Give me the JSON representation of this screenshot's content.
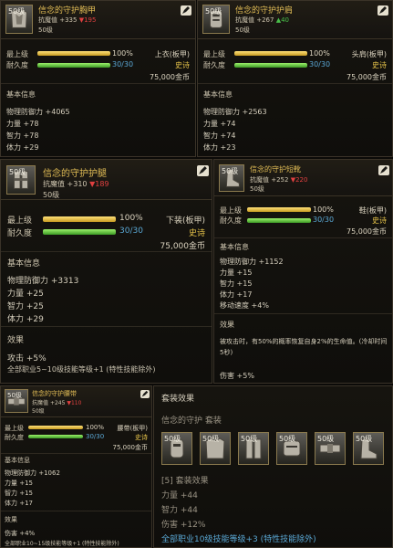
{
  "colors": {
    "gold": "#e2bd56",
    "reduce": "#e04040",
    "increase": "#49c04a",
    "cyan": "#5aa7d4",
    "durability": "#3c9a25",
    "upgrade": "#c79b21"
  },
  "labels": {
    "upgrade": "最上级",
    "durability": "耐久度",
    "basic": "基本信息",
    "effect": "效果",
    "rarity": "史诗"
  },
  "items": {
    "chest": {
      "title": "信念的守护胸甲",
      "icon": "chest-armor-icon",
      "level_badge": "50级",
      "atk_label": "抗魔值",
      "atk_up": "+335",
      "atk_down": "▼195",
      "level": "50级",
      "upgrade_pct": "100%",
      "upgrade_value": 1.0,
      "dur": "30/30",
      "dur_value": 1.0,
      "slot": "上衣(板甲)",
      "rarity": "史诗",
      "price": "75,000金币",
      "defense": "物理防御力 +4065",
      "stats": [
        "力量 +78",
        "智力 +78",
        "体力 +29"
      ]
    },
    "shoulder": {
      "title": "信念的守护护肩",
      "icon": "shoulder-armor-icon",
      "level_badge": "50级",
      "atk_label": "抗魔值",
      "atk_up": "+267",
      "atk_up2": "▲40",
      "level": "50级",
      "upgrade_pct": "100%",
      "upgrade_value": 1.0,
      "dur": "30/30",
      "dur_value": 1.0,
      "slot": "头肩(板甲)",
      "rarity": "史诗",
      "price": "75,000金币",
      "defense": "物理防御力 +2563",
      "stats": [
        "力量 +74",
        "智力 +74",
        "体力 +23"
      ]
    },
    "legs": {
      "title": "信念的守护护腿",
      "icon": "leg-armor-icon",
      "level_badge": "50级",
      "atk_label": "抗魔值",
      "atk_up": "+310",
      "atk_down": "▼189",
      "level": "50级",
      "upgrade_pct": "100%",
      "upgrade_value": 1.0,
      "dur": "30/30",
      "dur_value": 1.0,
      "slot": "下装(板甲)",
      "rarity": "史诗",
      "price": "75,000金币",
      "defense": "物理防御力 +3313",
      "stats": [
        "力量 +25",
        "智力 +25",
        "体力 +29"
      ],
      "effects": [
        "攻击 +5%",
        "全部职业5~10级技能等级+1 (特性技能除外)"
      ]
    },
    "boots": {
      "title": "信念的守护短靴",
      "icon": "boots-icon",
      "level_badge": "50级",
      "atk_label": "抗魔值",
      "atk_up": "+252",
      "atk_down": "▼220",
      "level": "50级",
      "upgrade_pct": "100%",
      "upgrade_value": 1.0,
      "dur": "30/30",
      "dur_value": 1.0,
      "slot": "鞋(板甲)",
      "rarity": "史诗",
      "price": "75,000金币",
      "defense": "物理防御力 +1152",
      "stats": [
        "力量 +15",
        "智力 +15",
        "体力 +17",
        "移动速度 +4%"
      ],
      "effects": [
        "被攻击时，有50%的概率恢复自身2%的生命值。(冷却时间5秒)",
        "伤害 +5%"
      ]
    },
    "belt": {
      "title": "信念的守护腰带",
      "icon": "belt-icon",
      "level_badge": "50级",
      "atk_label": "抗魔值",
      "atk_up": "+245",
      "atk_down": "▼110",
      "level": "50级",
      "upgrade_pct": "100%",
      "upgrade_value": 1.0,
      "dur": "30/30",
      "dur_value": 1.0,
      "slot": "腰带(板甲)",
      "rarity": "史诗",
      "price": "75,000金币",
      "defense": "物理防御力 +1062",
      "stats": [
        "力量 +15",
        "智力 +15",
        "体力 +17"
      ],
      "effects": [
        "伤害 +4%",
        "全部职业10~15级技能等级+1 (特性技能除外)"
      ]
    }
  },
  "set": {
    "title": "套装效果",
    "name": "信念的守护 套装",
    "icons": [
      {
        "level": "50级",
        "name": "helmet-icon"
      },
      {
        "level": "50级",
        "name": "chest-armor-icon"
      },
      {
        "level": "50级",
        "name": "leg-armor-icon"
      },
      {
        "level": "50级",
        "name": "shoulder-armor-icon"
      },
      {
        "level": "50级",
        "name": "belt-icon"
      },
      {
        "level": "50级",
        "name": "boots-icon"
      }
    ],
    "bonus_title": "[5] 套装效果",
    "bonus": [
      "力量 +44",
      "智力 +44",
      "伤害 +12%",
      "全部职业10级技能等级+3 (特性技能除外)"
    ]
  }
}
